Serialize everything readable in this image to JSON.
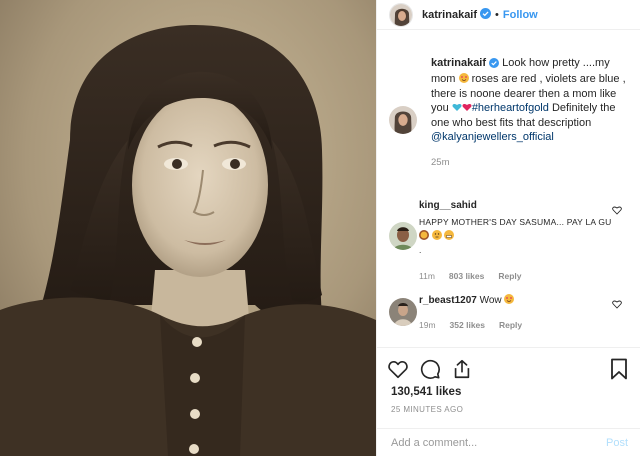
{
  "header": {
    "username": "katrinakaif",
    "separator": "•",
    "follow_label": "Follow"
  },
  "caption": {
    "username": "katrinakaif",
    "text_1": "Look how pretty ....my mom",
    "text_2": "roses are red , violets are blue , there is noone dearer then a mom like you",
    "hashtag": "#herheartofgold",
    "text_3": "Definitely the one who best fits that description",
    "mention": "@kalyanjewellers_official",
    "time": "25m",
    "icons": [
      "heart-eyes-emoji",
      "blue-heart-emoji",
      "red-heart-emoji"
    ]
  },
  "comments": [
    {
      "username": "king__sahid",
      "text": "HAPPY MOTHER'S DAY SASUMA... PAY LA GU",
      "trailing": ".",
      "time": "11m",
      "likes": "803 likes",
      "reply": "Reply",
      "icons": [
        "hug-emoji",
        "thinking-emoji",
        "grin-emoji"
      ]
    },
    {
      "username": "r_beast1207",
      "text": "Wow",
      "time": "19m",
      "likes": "352 likes",
      "reply": "Reply",
      "icons": [
        "heart-eyes-emoji"
      ]
    }
  ],
  "actions": {
    "likes": "130,541 likes",
    "ago": "25 MINUTES AGO",
    "icons": [
      "like-icon",
      "comment-icon",
      "share-icon",
      "bookmark-icon"
    ]
  },
  "composer": {
    "placeholder": "Add a comment...",
    "post_label": "Post"
  },
  "colors": {
    "link_blue": "#3897f0",
    "hashtag": "#00376b",
    "muted": "#8e8e8e",
    "verified": "#3897f0"
  }
}
